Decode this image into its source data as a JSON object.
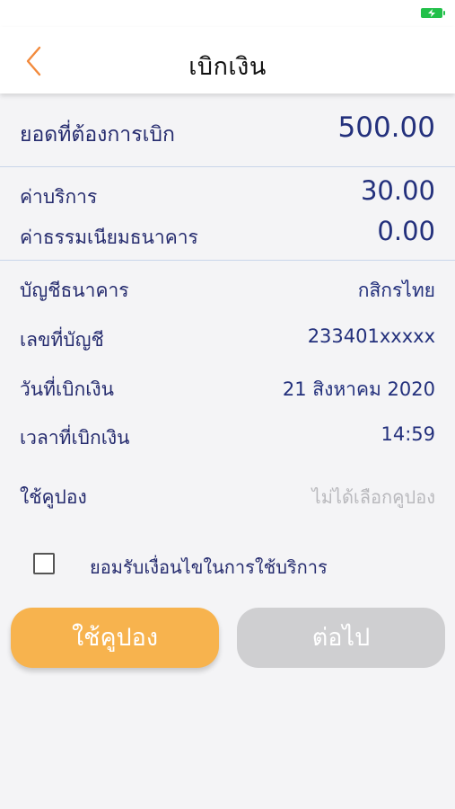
{
  "header": {
    "title": "เบิกเงิน"
  },
  "summary": {
    "amount_label": "ยอดที่ต้องการเบิก",
    "amount_value": "500.00",
    "service_fee_label": "ค่าบริการ",
    "service_fee_value": "30.00",
    "bank_fee_label": "ค่าธรรมเนียมธนาคาร",
    "bank_fee_value": "0.00"
  },
  "details": {
    "bank_label": "บัญชีธนาคาร",
    "bank_value": "กสิกรไทย",
    "account_label": "เลขที่บัญชี",
    "account_value": "233401xxxxx",
    "date_label": "วันที่เบิกเงิน",
    "date_value": "21 สิงหาคม 2020",
    "time_label": "เวลาที่เบิกเงิน",
    "time_value": "14:59",
    "coupon_label": "ใช้คูปอง",
    "coupon_placeholder": "ไม่ได้เลือกคูปอง"
  },
  "terms": {
    "label": "ยอมรับเงื่อนไขในการใช้บริการ",
    "checked": false
  },
  "buttons": {
    "coupon_label": "ใช้คูปอง",
    "next_label": "ต่อไป"
  },
  "colors": {
    "accent_orange": "#f7b34e",
    "text_navy": "#23307c",
    "disabled_gray": "#cfcfd1",
    "battery_green": "#22c04a",
    "back_arrow": "#f28a3c"
  },
  "icons": {
    "back": "chevron-left-icon",
    "battery": "battery-charging-icon"
  }
}
